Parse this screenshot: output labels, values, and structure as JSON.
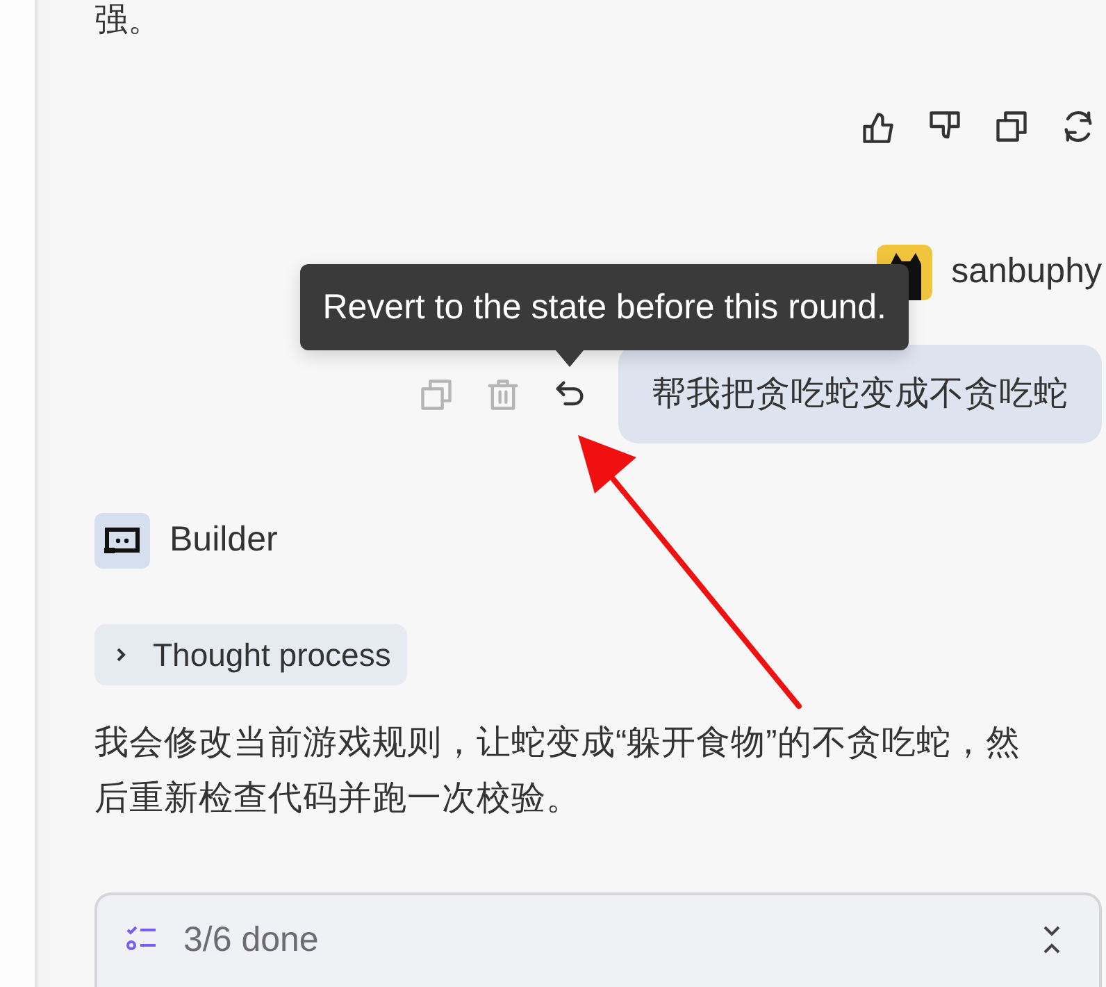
{
  "previous_reply": {
    "text": "强。",
    "actions": [
      {
        "kind": "like"
      },
      {
        "kind": "dislike"
      },
      {
        "kind": "copy"
      },
      {
        "kind": "regenerate"
      }
    ]
  },
  "user_message": {
    "username": "sanbuphy",
    "text": "帮我把贪吃蛇变成不贪吃蛇",
    "actions": [
      {
        "kind": "copy",
        "disabled": true
      },
      {
        "kind": "delete",
        "disabled": true
      },
      {
        "kind": "revert",
        "disabled": false
      }
    ]
  },
  "tooltip": {
    "text": "Revert to the state before this round."
  },
  "assistant": {
    "name": "Builder",
    "thought": {
      "label": "Thought process",
      "expanded": false
    },
    "text": "我会修改当前游戏规则，让蛇变成“躲开食物”的不贪吃蛇，然后重新检查代码并跑一次校验。",
    "todo": {
      "progress": "3/6 done",
      "expanded": true
    }
  }
}
